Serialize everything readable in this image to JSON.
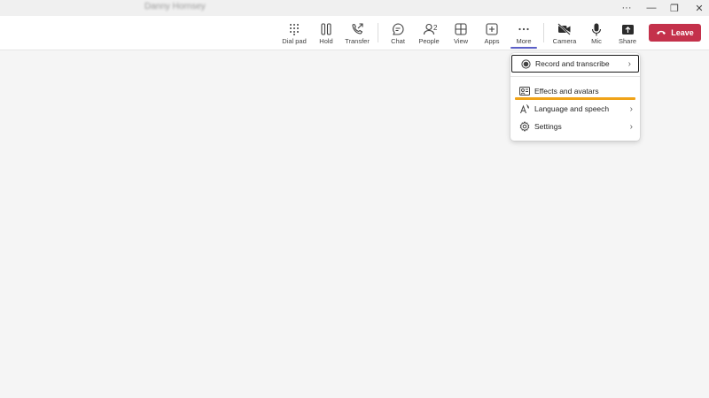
{
  "window": {
    "caller_name": "Danny Hornsey",
    "controls": {
      "more": "···",
      "minimize": "—",
      "restore": "❐",
      "close": "✕"
    }
  },
  "toolbar": {
    "dial_pad": "Dial pad",
    "hold": "Hold",
    "transfer": "Transfer",
    "chat": "Chat",
    "people": "People",
    "people_count": "2",
    "view": "View",
    "apps": "Apps",
    "more": "More",
    "camera": "Camera",
    "mic": "Mic",
    "share": "Share",
    "leave": "Leave"
  },
  "more_menu": {
    "items": [
      {
        "label": "Record and transcribe",
        "icon": "record-icon",
        "has_submenu": true,
        "focused": true
      },
      {
        "label": "Effects and avatars",
        "icon": "effects-icon",
        "has_submenu": false
      },
      {
        "label": "Language and speech",
        "icon": "language-icon",
        "has_submenu": true
      },
      {
        "label": "Settings",
        "icon": "gear-icon",
        "has_submenu": true
      }
    ],
    "chevron": "›"
  },
  "colors": {
    "leave_button": "#c4314b",
    "active_tab_underline": "#5b5fc7",
    "highlight_annotation": "#f0a318"
  }
}
